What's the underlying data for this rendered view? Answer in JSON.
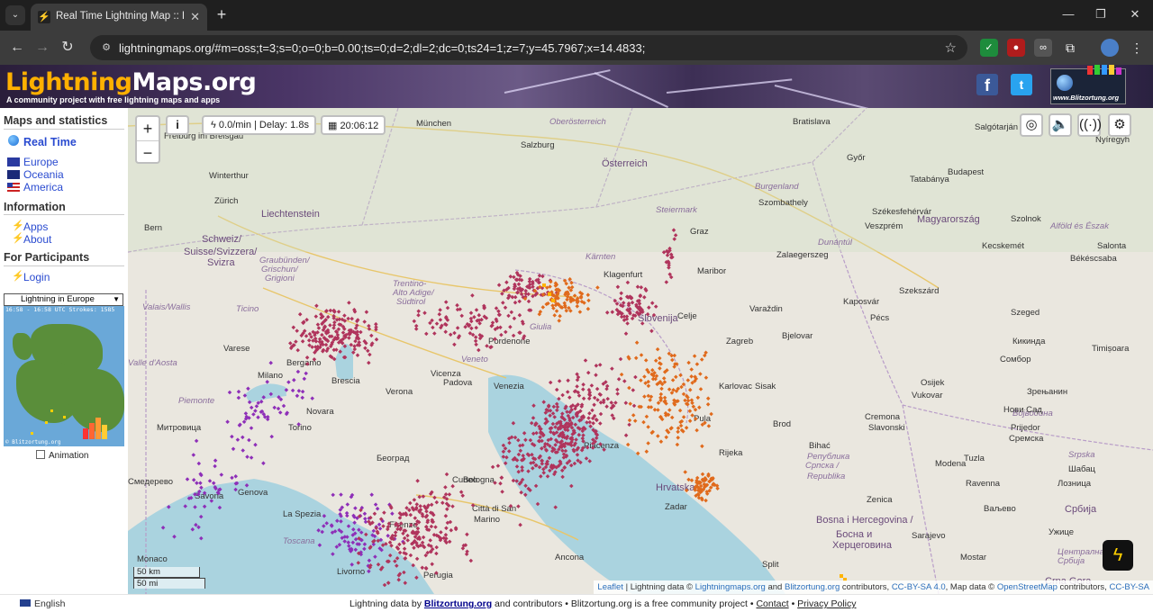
{
  "browser": {
    "tab_title": "Real Time Lightning Map :: Lightning",
    "url": "lightningmaps.org/#m=oss;t=3;s=0;o=0;b=0.00;ts=0;d=2;dl=2;dc=0;ts24=1;z=7;y=45.7967;x=14.4833;"
  },
  "header": {
    "logo_part1": "Lightning",
    "logo_part2": "Maps.org",
    "tagline": "A community project with free lightning maps and apps",
    "partner_caption": "www.Blitzortung.org"
  },
  "sidebar": {
    "maps_title": "Maps and statistics",
    "realtime": "Real Time",
    "europe": "Europe",
    "oceania": "Oceania",
    "america": "America",
    "info_title": "Information",
    "apps": "Apps",
    "about": "About",
    "participants_title": "For Participants",
    "login": "Login",
    "select_value": "Lightning in Europe",
    "minimap_header": "16:58 - 16:58 UTC Strokes: 1585",
    "minimap_footer": "© Blitzortung.org",
    "animation": "Animation"
  },
  "map": {
    "rate": "0.0/min | Delay: 1.8s",
    "time": "20:06:12",
    "scale_km": "50 km",
    "scale_mi": "50 mi",
    "attribution_leaflet": "Leaflet",
    "attribution_text1": " | Lightning data © ",
    "attribution_link1": "Lightningmaps.org",
    "attribution_and": " and ",
    "attribution_link2": "Blitzortung.org",
    "attribution_text2": " contributors, ",
    "attribution_link3": "CC-BY-SA 4.0",
    "attribution_text3": ", Map data © ",
    "attribution_link4": "OpenStreetMap",
    "attribution_text4": " contributors, ",
    "attribution_link5": "CC-BY-SA"
  },
  "footer": {
    "language": "English",
    "text_before": "Lightning data by ",
    "blitz": "Blitzortung.org",
    "text_after": " and contributors • Blitzortung.org is a free community project • ",
    "contact": "Contact",
    "sep": " • ",
    "privacy": "Privacy Policy"
  },
  "colors": {
    "strike_old": "#8e2fb8",
    "strike_mid": "#b0345c",
    "strike_new": "#e06a1c",
    "strike_newest": "#ffb400",
    "water": "#aad3df"
  },
  "places": [
    {
      "name": "Oberösterreich",
      "kind": "region"
    },
    {
      "name": "Bratislava",
      "kind": "city"
    },
    {
      "name": "Salgótarján",
      "kind": "city"
    },
    {
      "name": "Nyíregyh",
      "kind": "city"
    },
    {
      "name": "Freiburg im Breisgau",
      "kind": "city"
    },
    {
      "name": "München",
      "kind": "city"
    },
    {
      "name": "Salzburg",
      "kind": "city"
    },
    {
      "name": "Österreich",
      "kind": "country"
    },
    {
      "name": "Győr",
      "kind": "city"
    },
    {
      "name": "Budapest",
      "kind": "city"
    },
    {
      "name": "Tatabánya",
      "kind": "city"
    },
    {
      "name": "Winterthur",
      "kind": "city"
    },
    {
      "name": "Burgenland",
      "kind": "region"
    },
    {
      "name": "Szombathely",
      "kind": "city"
    },
    {
      "name": "Zürich",
      "kind": "city"
    },
    {
      "name": "Liechtenstein",
      "kind": "country"
    },
    {
      "name": "Steiermark",
      "kind": "region"
    },
    {
      "name": "Székesfehérvár",
      "kind": "city"
    },
    {
      "name": "Magyarország",
      "kind": "country"
    },
    {
      "name": "Szolnok",
      "kind": "city"
    },
    {
      "name": "Alföld és Észak",
      "kind": "region"
    },
    {
      "name": "Bern",
      "kind": "city"
    },
    {
      "name": "Schweiz/",
      "kind": "country"
    },
    {
      "name": "Suisse/Svizzera/",
      "kind": "country"
    },
    {
      "name": "Svizra",
      "kind": "country"
    },
    {
      "name": "Graz",
      "kind": "city"
    },
    {
      "name": "Veszprém",
      "kind": "city"
    },
    {
      "name": "Dunántúl",
      "kind": "region"
    },
    {
      "name": "Kecskemét",
      "kind": "city"
    },
    {
      "name": "Salonta",
      "kind": "city"
    },
    {
      "name": "Zalaegerszeg",
      "kind": "city"
    },
    {
      "name": "Békéscsaba",
      "kind": "city"
    },
    {
      "name": "Graubünden/",
      "kind": "region"
    },
    {
      "name": "Grischun/",
      "kind": "region"
    },
    {
      "name": "Grigioni",
      "kind": "region"
    },
    {
      "name": "Kärnten",
      "kind": "region"
    },
    {
      "name": "Klagenfurt",
      "kind": "city"
    },
    {
      "name": "Maribor",
      "kind": "city"
    },
    {
      "name": "Trentino-",
      "kind": "region"
    },
    {
      "name": "Alto Adige/",
      "kind": "region"
    },
    {
      "name": "Südtirol",
      "kind": "region"
    },
    {
      "name": "Szekszárd",
      "kind": "city"
    },
    {
      "name": "Valais/Wallis",
      "kind": "region"
    },
    {
      "name": "Ticino",
      "kind": "region"
    },
    {
      "name": "Celje",
      "kind": "city"
    },
    {
      "name": "Slovenija",
      "kind": "country"
    },
    {
      "name": "Varaždin",
      "kind": "city"
    },
    {
      "name": "Kaposvár",
      "kind": "city"
    },
    {
      "name": "Szeged",
      "kind": "city"
    },
    {
      "name": "Pécs",
      "kind": "city"
    },
    {
      "name": "Giulia",
      "kind": "region"
    },
    {
      "name": "Pordenone",
      "kind": "city"
    },
    {
      "name": "Bjelovar",
      "kind": "city"
    },
    {
      "name": "Кикинда",
      "kind": "city"
    },
    {
      "name": "Timișoara",
      "kind": "city"
    },
    {
      "name": "Varese",
      "kind": "city"
    },
    {
      "name": "Bergamo",
      "kind": "city"
    },
    {
      "name": "Zagreb",
      "kind": "city"
    },
    {
      "name": "Сомбор",
      "kind": "city"
    },
    {
      "name": "Milano",
      "kind": "city"
    },
    {
      "name": "Brescia",
      "kind": "city"
    },
    {
      "name": "Vicenza",
      "kind": "city"
    },
    {
      "name": "Veneto",
      "kind": "region"
    },
    {
      "name": "Karlovac",
      "kind": "city"
    },
    {
      "name": "Osijek",
      "kind": "city"
    },
    {
      "name": "Valle d'Aosta",
      "kind": "region"
    },
    {
      "name": "Verona",
      "kind": "city"
    },
    {
      "name": "Padova",
      "kind": "city"
    },
    {
      "name": "Venezia",
      "kind": "city"
    },
    {
      "name": "Sisak",
      "kind": "city"
    },
    {
      "name": "Vukovar",
      "kind": "city"
    },
    {
      "name": "Зрењанин",
      "kind": "city"
    },
    {
      "name": "Piemonte",
      "kind": "region"
    },
    {
      "name": "Novara",
      "kind": "city"
    },
    {
      "name": "Војводина",
      "kind": "region"
    },
    {
      "name": "Нови Сад",
      "kind": "city"
    },
    {
      "name": "Cremona",
      "kind": "city"
    },
    {
      "name": "Slavonski",
      "kind": "city"
    },
    {
      "name": "Brod",
      "kind": "city"
    },
    {
      "name": "Prijedor",
      "kind": "city"
    },
    {
      "name": "Сремска",
      "kind": "city"
    },
    {
      "name": "Митровица",
      "kind": "city"
    },
    {
      "name": "Torino",
      "kind": "city"
    },
    {
      "name": "Piacenza",
      "kind": "city"
    },
    {
      "name": "Pula",
      "kind": "city"
    },
    {
      "name": "Rijeka",
      "kind": "city"
    },
    {
      "name": "Bihać",
      "kind": "city"
    },
    {
      "name": "Република",
      "kind": "region"
    },
    {
      "name": "Српска /",
      "kind": "region"
    },
    {
      "name": "Republika",
      "kind": "region"
    },
    {
      "name": "Srpska",
      "kind": "region"
    },
    {
      "name": "Београд",
      "kind": "city"
    },
    {
      "name": "Modena",
      "kind": "city"
    },
    {
      "name": "Tuzla",
      "kind": "city"
    },
    {
      "name": "Шабац",
      "kind": "city"
    },
    {
      "name": "Смедерево",
      "kind": "city"
    },
    {
      "name": "Cuneo",
      "kind": "city"
    },
    {
      "name": "Bologna",
      "kind": "city"
    },
    {
      "name": "Ravenna",
      "kind": "city"
    },
    {
      "name": "Лозница",
      "kind": "city"
    },
    {
      "name": "Genova",
      "kind": "city"
    },
    {
      "name": "Savona",
      "kind": "city"
    },
    {
      "name": "Hrvatska",
      "kind": "country"
    },
    {
      "name": "Zenica",
      "kind": "city"
    },
    {
      "name": "Ваљево",
      "kind": "city"
    },
    {
      "name": "Zadar",
      "kind": "city"
    },
    {
      "name": "Città di San",
      "kind": "city"
    },
    {
      "name": "Marino",
      "kind": "city"
    },
    {
      "name": "Србија",
      "kind": "country"
    },
    {
      "name": "La Spezia",
      "kind": "city"
    },
    {
      "name": "Firenze",
      "kind": "city"
    },
    {
      "name": "Bosna i Hercegovina /",
      "kind": "country"
    },
    {
      "name": "Босна и",
      "kind": "country"
    },
    {
      "name": "Херцеговина",
      "kind": "country"
    },
    {
      "name": "Sarajevo",
      "kind": "city"
    },
    {
      "name": "Ужице",
      "kind": "city"
    },
    {
      "name": "Централна",
      "kind": "region"
    },
    {
      "name": "Србија",
      "kind": "region"
    },
    {
      "name": "Monaco",
      "kind": "city"
    },
    {
      "name": "Ancona",
      "kind": "city"
    },
    {
      "name": "Split",
      "kind": "city"
    },
    {
      "name": "Mostar",
      "kind": "city"
    },
    {
      "name": "Livorno",
      "kind": "city"
    },
    {
      "name": "Toscana",
      "kind": "region"
    },
    {
      "name": "Perugia",
      "kind": "city"
    },
    {
      "name": "Crna Gora",
      "kind": "country"
    }
  ]
}
